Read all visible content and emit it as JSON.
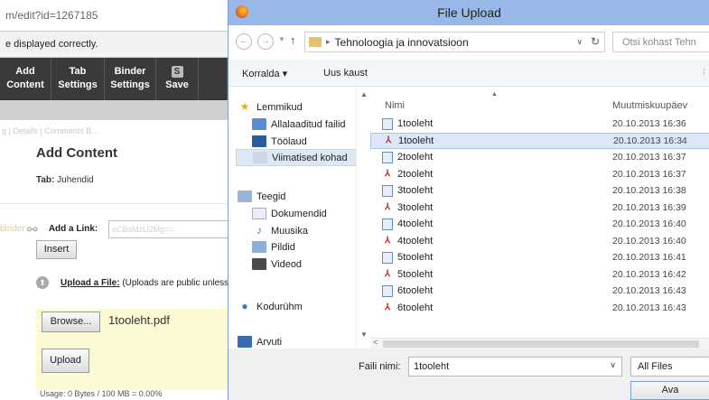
{
  "browser": {
    "url": "m/edit?id=1267185",
    "warning": "e displayed correctly.",
    "toolbar": [
      {
        "line1": "Add",
        "line2": "Content"
      },
      {
        "line1": "Tab",
        "line2": "Settings"
      },
      {
        "line1": "Binder",
        "line2": "Settings"
      },
      {
        "line1": "S",
        "line2": "Save"
      }
    ],
    "breadcrumbs": "g | Details | Comments B...",
    "heading": "Add Content",
    "tab_label": "Tab:",
    "tab_value": "Juhendid",
    "link_row_faded": "binder",
    "link_label": "Add a Link:",
    "link_placeholder": "eCBsMzU2Mg==",
    "insert_label": "Insert",
    "upload_file_label": "Upload a File:",
    "upload_note": "(Uploads are public unless",
    "browse_label": "Browse...",
    "selected_file": "1tooleht.pdf",
    "upload_label": "Upload",
    "usage": "Usage: 0 Bytes / 100 MB = 0.00%"
  },
  "dialog": {
    "title": "File Upload",
    "path": "Tehnoloogia ja innovatsioon",
    "search_placeholder": "Otsi kohast Tehn",
    "organize": "Korralda ▾",
    "new_folder": "Uus kaust",
    "nav": [
      {
        "label": "Lemmikud",
        "icon": "star-icon"
      },
      {
        "label": "Allalaaditud failid",
        "icon": "downloads-folder-icon"
      },
      {
        "label": "Töölaud",
        "icon": "desktop-icon"
      },
      {
        "label": "Viimatised kohad",
        "icon": "recent-places-icon"
      },
      {
        "label": "Teegid",
        "icon": "libraries-icon"
      },
      {
        "label": "Dokumendid",
        "icon": "documents-icon"
      },
      {
        "label": "Muusika",
        "icon": "music-icon"
      },
      {
        "label": "Pildid",
        "icon": "pictures-icon"
      },
      {
        "label": "Videod",
        "icon": "videos-icon"
      },
      {
        "label": "Kodurühm",
        "icon": "homegroup-icon"
      },
      {
        "label": "Arvuti",
        "icon": "computer-icon"
      }
    ],
    "columns": {
      "name": "Nimi",
      "date": "Muutmiskuupäev"
    },
    "files": [
      {
        "name": "1tooleht",
        "type": "doc",
        "date": "20.10.2013 16:36"
      },
      {
        "name": "1tooleht",
        "type": "pdf",
        "date": "20.10.2013 16:34"
      },
      {
        "name": "2tooleht",
        "type": "doc",
        "date": "20.10.2013 16:37"
      },
      {
        "name": "2tooleht",
        "type": "pdf",
        "date": "20.10.2013 16:37"
      },
      {
        "name": "3tooleht",
        "type": "doc",
        "date": "20.10.2013 16:38"
      },
      {
        "name": "3tooleht",
        "type": "pdf",
        "date": "20.10.2013 16:39"
      },
      {
        "name": "4tooleht",
        "type": "doc",
        "date": "20.10.2013 16:40"
      },
      {
        "name": "4tooleht",
        "type": "pdf",
        "date": "20.10.2013 16:40"
      },
      {
        "name": "5tooleht",
        "type": "doc",
        "date": "20.10.2013 16:41"
      },
      {
        "name": "5tooleht",
        "type": "pdf",
        "date": "20.10.2013 16:42"
      },
      {
        "name": "6tooleht",
        "type": "doc",
        "date": "20.10.2013 16:43"
      },
      {
        "name": "6tooleht",
        "type": "pdf",
        "date": "20.10.2013 16:43"
      }
    ],
    "filename_label": "Faili nimi:",
    "filename_value": "1tooleht",
    "filter": "All Files",
    "open_label": "Ava"
  }
}
